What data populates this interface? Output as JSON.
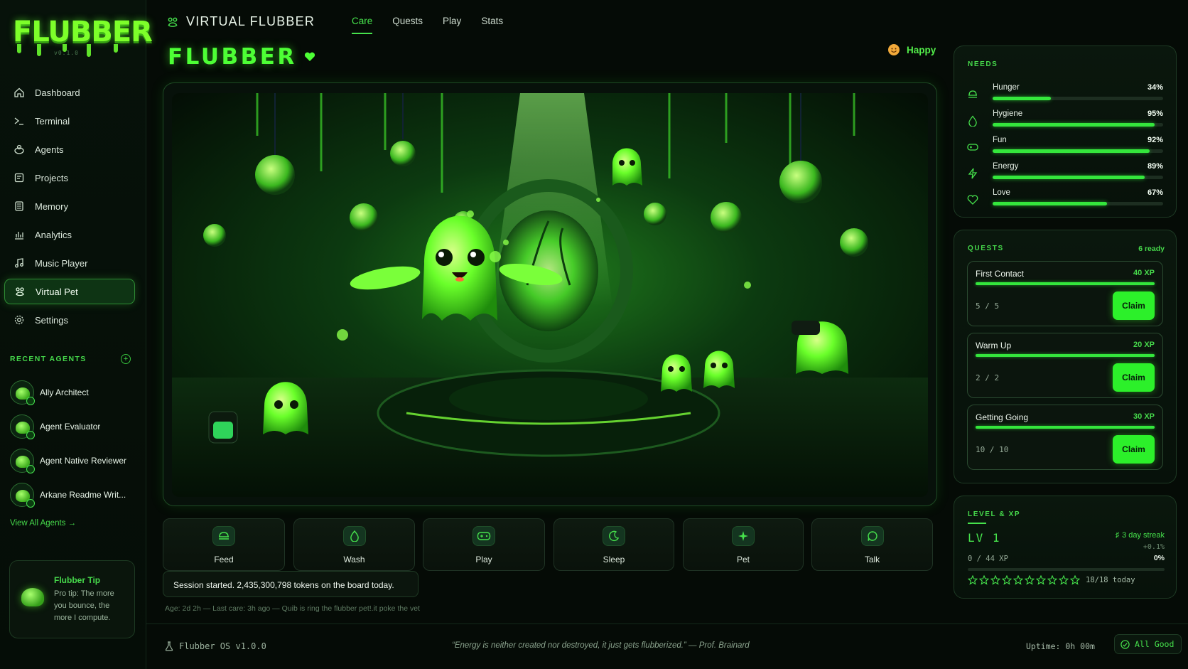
{
  "app": {
    "logo": "FLUBBER",
    "version": "v0.1.0"
  },
  "sidebar": {
    "items": [
      {
        "label": "Dashboard",
        "icon": "home-icon"
      },
      {
        "label": "Terminal",
        "icon": "terminal-icon"
      },
      {
        "label": "Agents",
        "icon": "agents-icon"
      },
      {
        "label": "Projects",
        "icon": "projects-icon"
      },
      {
        "label": "Memory",
        "icon": "memory-icon"
      },
      {
        "label": "Analytics",
        "icon": "analytics-icon"
      },
      {
        "label": "Music Player",
        "icon": "music-icon"
      },
      {
        "label": "Virtual Pet",
        "icon": "pet-icon",
        "active": true
      },
      {
        "label": "Settings",
        "icon": "gear-icon"
      }
    ],
    "recent_title": "RECENT AGENTS",
    "agents": [
      {
        "name": "Ally Architect"
      },
      {
        "name": "Agent Evaluator"
      },
      {
        "name": "Agent Native Reviewer"
      },
      {
        "name": "Arkane Readme Writ..."
      }
    ],
    "view_all": "View All Agents →",
    "tip": {
      "title": "Flubber Tip",
      "body": "Pro tip: The more you bounce, the more I compute."
    }
  },
  "header": {
    "title": "VIRTUAL FLUBBER",
    "tabs": [
      {
        "label": "Care",
        "active": true
      },
      {
        "label": "Quests"
      },
      {
        "label": "Play"
      },
      {
        "label": "Stats"
      }
    ],
    "pet_name": "FLUBBER",
    "mood": "Happy"
  },
  "actions": [
    {
      "label": "Feed",
      "icon": "food-icon"
    },
    {
      "label": "Wash",
      "icon": "wash-icon"
    },
    {
      "label": "Play",
      "icon": "gamepad-icon"
    },
    {
      "label": "Sleep",
      "icon": "moon-icon"
    },
    {
      "label": "Pet",
      "icon": "sparkle-icon"
    },
    {
      "label": "Talk",
      "icon": "chat-icon"
    }
  ],
  "session_message": "Session started. 2,435,300,798 tokens on the board today.",
  "meta_line": "Age: 2d 2h — Last care: 3h ago — Quib is ring the flubber  pet!.it poke the vet",
  "needs": {
    "title": "NEEDS",
    "items": [
      {
        "label": "Hunger",
        "value": "34%",
        "level": 34,
        "icon": "food-icon"
      },
      {
        "label": "Hygiene",
        "value": "95%",
        "level": 95,
        "icon": "droplet-icon"
      },
      {
        "label": "Fun",
        "value": "92%",
        "level": 92,
        "icon": "gamepad-icon"
      },
      {
        "label": "Energy",
        "value": "89%",
        "level": 89,
        "icon": "bolt-icon"
      },
      {
        "label": "Love",
        "value": "67%",
        "level": 67,
        "icon": "heart-icon"
      }
    ]
  },
  "quests": {
    "title": "QUESTS",
    "ready": "6 ready",
    "items": [
      {
        "name": "First Contact",
        "xp": "40 XP",
        "progress": "5 / 5",
        "level": 100,
        "claim": "Claim"
      },
      {
        "name": "Warm Up",
        "xp": "20 XP",
        "progress": "2 / 2",
        "level": 100,
        "claim": "Claim"
      },
      {
        "name": "Getting Going",
        "xp": "30 XP",
        "progress": "10 / 10",
        "level": 100,
        "claim": "Claim"
      }
    ]
  },
  "level": {
    "title": "LEVEL & XP",
    "lv": "LV 1",
    "streak": "3 day streak",
    "xp_sub": "+0.1%",
    "xp_text": "0 / 44 XP",
    "xp_pct": "0%",
    "stars_filled": 0,
    "stars_total": 10,
    "today": "18/18 today"
  },
  "footer": {
    "os": "Flubber OS v1.0.0",
    "quote": "“Energy is neither created nor destroyed, it just gets flubberized.” — Prof. Brainard",
    "uptime": "Uptime: 0h 00m",
    "status": "All Good"
  },
  "colors": {
    "accent": "#46e24c",
    "bright": "#2cf02a",
    "bg": "#050b06"
  }
}
